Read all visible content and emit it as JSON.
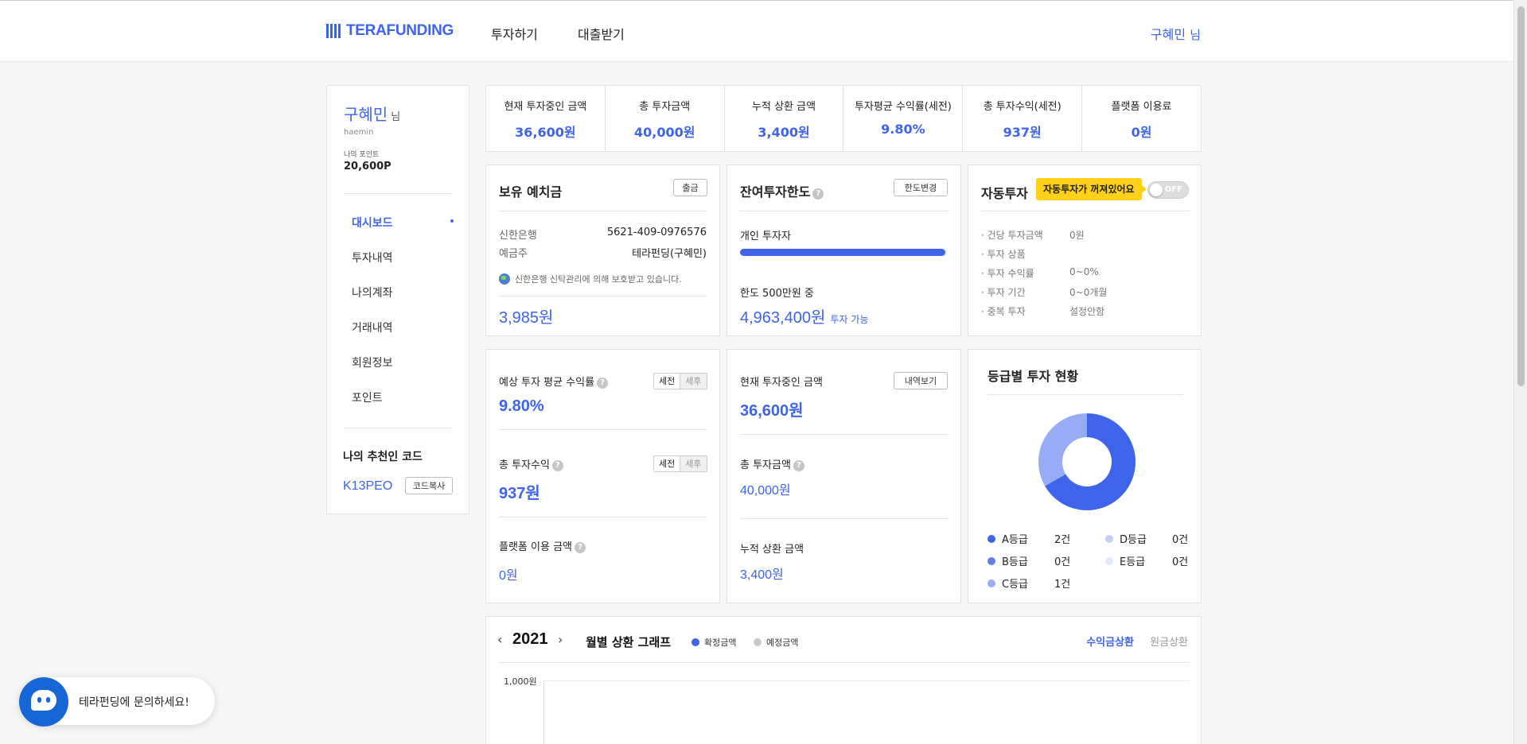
{
  "header": {
    "logo_text": "TERAFUNDING",
    "nav": [
      "투자하기",
      "대출받기"
    ],
    "user_name": "구혜민",
    "user_suffix": "님"
  },
  "sidebar": {
    "name": "구혜민",
    "name_suffix": "님",
    "user_id": "haemin",
    "points_label": "나의 포인트",
    "points_value": "20,600P",
    "menu": [
      "대시보드",
      "투자내역",
      "나의계좌",
      "거래내역",
      "회원정보",
      "포인트"
    ],
    "active_menu": "대시보드",
    "referral_title": "나의 추천인 코드",
    "referral_code": "K13PEO",
    "copy_button": "코드복사"
  },
  "stats": [
    {
      "label": "현재 투자중인 금액",
      "value": "36,600원"
    },
    {
      "label": "총 투자금액",
      "value": "40,000원"
    },
    {
      "label": "누적 상환 금액",
      "value": "3,400원"
    },
    {
      "label": "투자평균 수익률(세전)",
      "value": "9.80%"
    },
    {
      "label": "총 투자수익(세전)",
      "value": "937원"
    },
    {
      "label": "플랫폼 이용료",
      "value": "0원"
    }
  ],
  "deposit": {
    "title": "보유 예치금",
    "withdraw_button": "출금",
    "bank_label": "신한은행",
    "account_number": "5621-409-0976576",
    "holder_label": "예금주",
    "holder_value": "테라펀딩(구혜민)",
    "notice": "신한은행 신탁관리에 의해 보호받고 있습니다.",
    "balance": "3,985원"
  },
  "limit": {
    "title": "잔여투자한도",
    "change_button": "한도변경",
    "investor_type": "개인 투자자",
    "progress_fraction": 0.993,
    "limit_text": "한도 500만원 중",
    "remaining": "4,963,400원",
    "remaining_suffix": "투자 가능"
  },
  "auto": {
    "title": "자동투자",
    "badge": "자동투자가 꺼져있어요",
    "switch_label": "OFF",
    "rows": [
      {
        "label": "· 건당 투자금액",
        "value": "0원"
      },
      {
        "label": "· 투자 상품",
        "value": ""
      },
      {
        "label": "· 투자 수익률",
        "value": "0~0%"
      },
      {
        "label": "· 투자 기간",
        "value": "0~0개월"
      },
      {
        "label": "· 중복 투자",
        "value": "설정안함"
      }
    ]
  },
  "returns": {
    "avg_label": "예상 투자 평균 수익률",
    "avg_value": "9.80%",
    "total_label": "총 투자수익",
    "total_value": "937원",
    "fee_label": "플랫폼 이용 금액",
    "fee_value": "0원",
    "pre_tax": "세전",
    "post_tax": "세후"
  },
  "investing": {
    "current_label": "현재 투자중인 금액",
    "current_value": "36,600원",
    "history_button": "내역보기",
    "total_label": "총 투자금액",
    "total_value": "40,000원",
    "repaid_label": "누적 상환 금액",
    "repaid_value": "3,400원"
  },
  "grade": {
    "title": "등급별 투자 현황",
    "items": [
      {
        "grade": "A등급",
        "count": "2건",
        "color": "#3d64ea"
      },
      {
        "grade": "B등급",
        "count": "0건",
        "color": "#5f80ee"
      },
      {
        "grade": "C등급",
        "count": "1건",
        "color": "#98abf5"
      },
      {
        "grade": "D등급",
        "count": "0건",
        "color": "#c3cdfa"
      },
      {
        "grade": "E등급",
        "count": "0건",
        "color": "#e4e8fd"
      }
    ]
  },
  "chart_data": {
    "type": "bar",
    "title": "월별 상환 그래프",
    "year": "2021",
    "series": [
      {
        "name": "확정금액",
        "color": "#3d64ea"
      },
      {
        "name": "예정금액",
        "color": "#c8c8c8"
      }
    ],
    "y_ticks": [
      "1,000원"
    ],
    "tabs": [
      "수익금상환",
      "원금상환"
    ],
    "active_tab": "수익금상환"
  },
  "chat": {
    "label": "테라펀딩에 문의하세요!"
  }
}
